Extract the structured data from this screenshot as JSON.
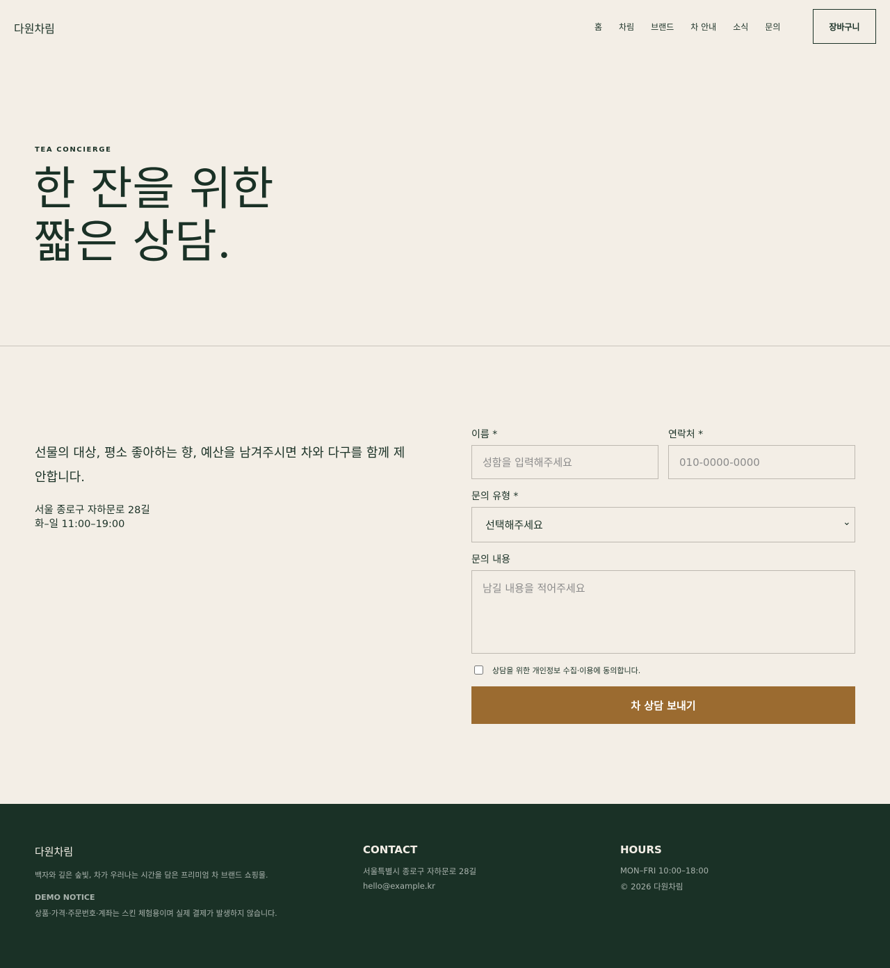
{
  "header": {
    "logo": "다원차림",
    "nav": [
      "홈",
      "차림",
      "브랜드",
      "차 안내",
      "소식",
      "문의"
    ],
    "cart_label": "장바구니"
  },
  "hero": {
    "eyebrow": "TEA CONCIERGE",
    "title": "한 잔을 위한\n짧은 상담."
  },
  "info": {
    "intro": "선물의 대상, 평소 좋아하는 향, 예산을 남겨주시면 차와 다구를 함께 제안합니다.",
    "address": "서울 종로구 자하문로 28길",
    "hours": "화–일 11:00–19:00"
  },
  "form": {
    "name_label": "이름 *",
    "name_placeholder": "성함을 입력해주세요",
    "phone_label": "연락처 *",
    "phone_placeholder": "010-0000-0000",
    "type_label": "문의 유형 *",
    "type_selected": "선택해주세요",
    "message_label": "문의 내용",
    "message_placeholder": "남길 내용을 적어주세요",
    "consent_label": "상담을 위한 개인정보 수집·이용에 동의합니다.",
    "submit_label": "차 상담 보내기"
  },
  "footer": {
    "brand": "다원차림",
    "tagline": "백자와 깊은 숲빛, 차가 우러나는 시간을 담은 프리미엄 차 브랜드 쇼핑몰.",
    "notice_title": "DEMO NOTICE",
    "notice": "상품·가격·주문번호·계좌는 스킨 체험용이며 실제 결제가 발생하지 않습니다.",
    "contact_title": "CONTACT",
    "contact_address": "서울특별시 종로구 자하문로 28길",
    "contact_email": "hello@example.kr",
    "hours_title": "HOURS",
    "hours_line": "MON–FRI 10:00–18:00",
    "copyright": "© 2026 다원차림"
  },
  "colors": {
    "background": "#f3eee6",
    "primary": "#1a3126",
    "accent": "#9b6b30"
  }
}
